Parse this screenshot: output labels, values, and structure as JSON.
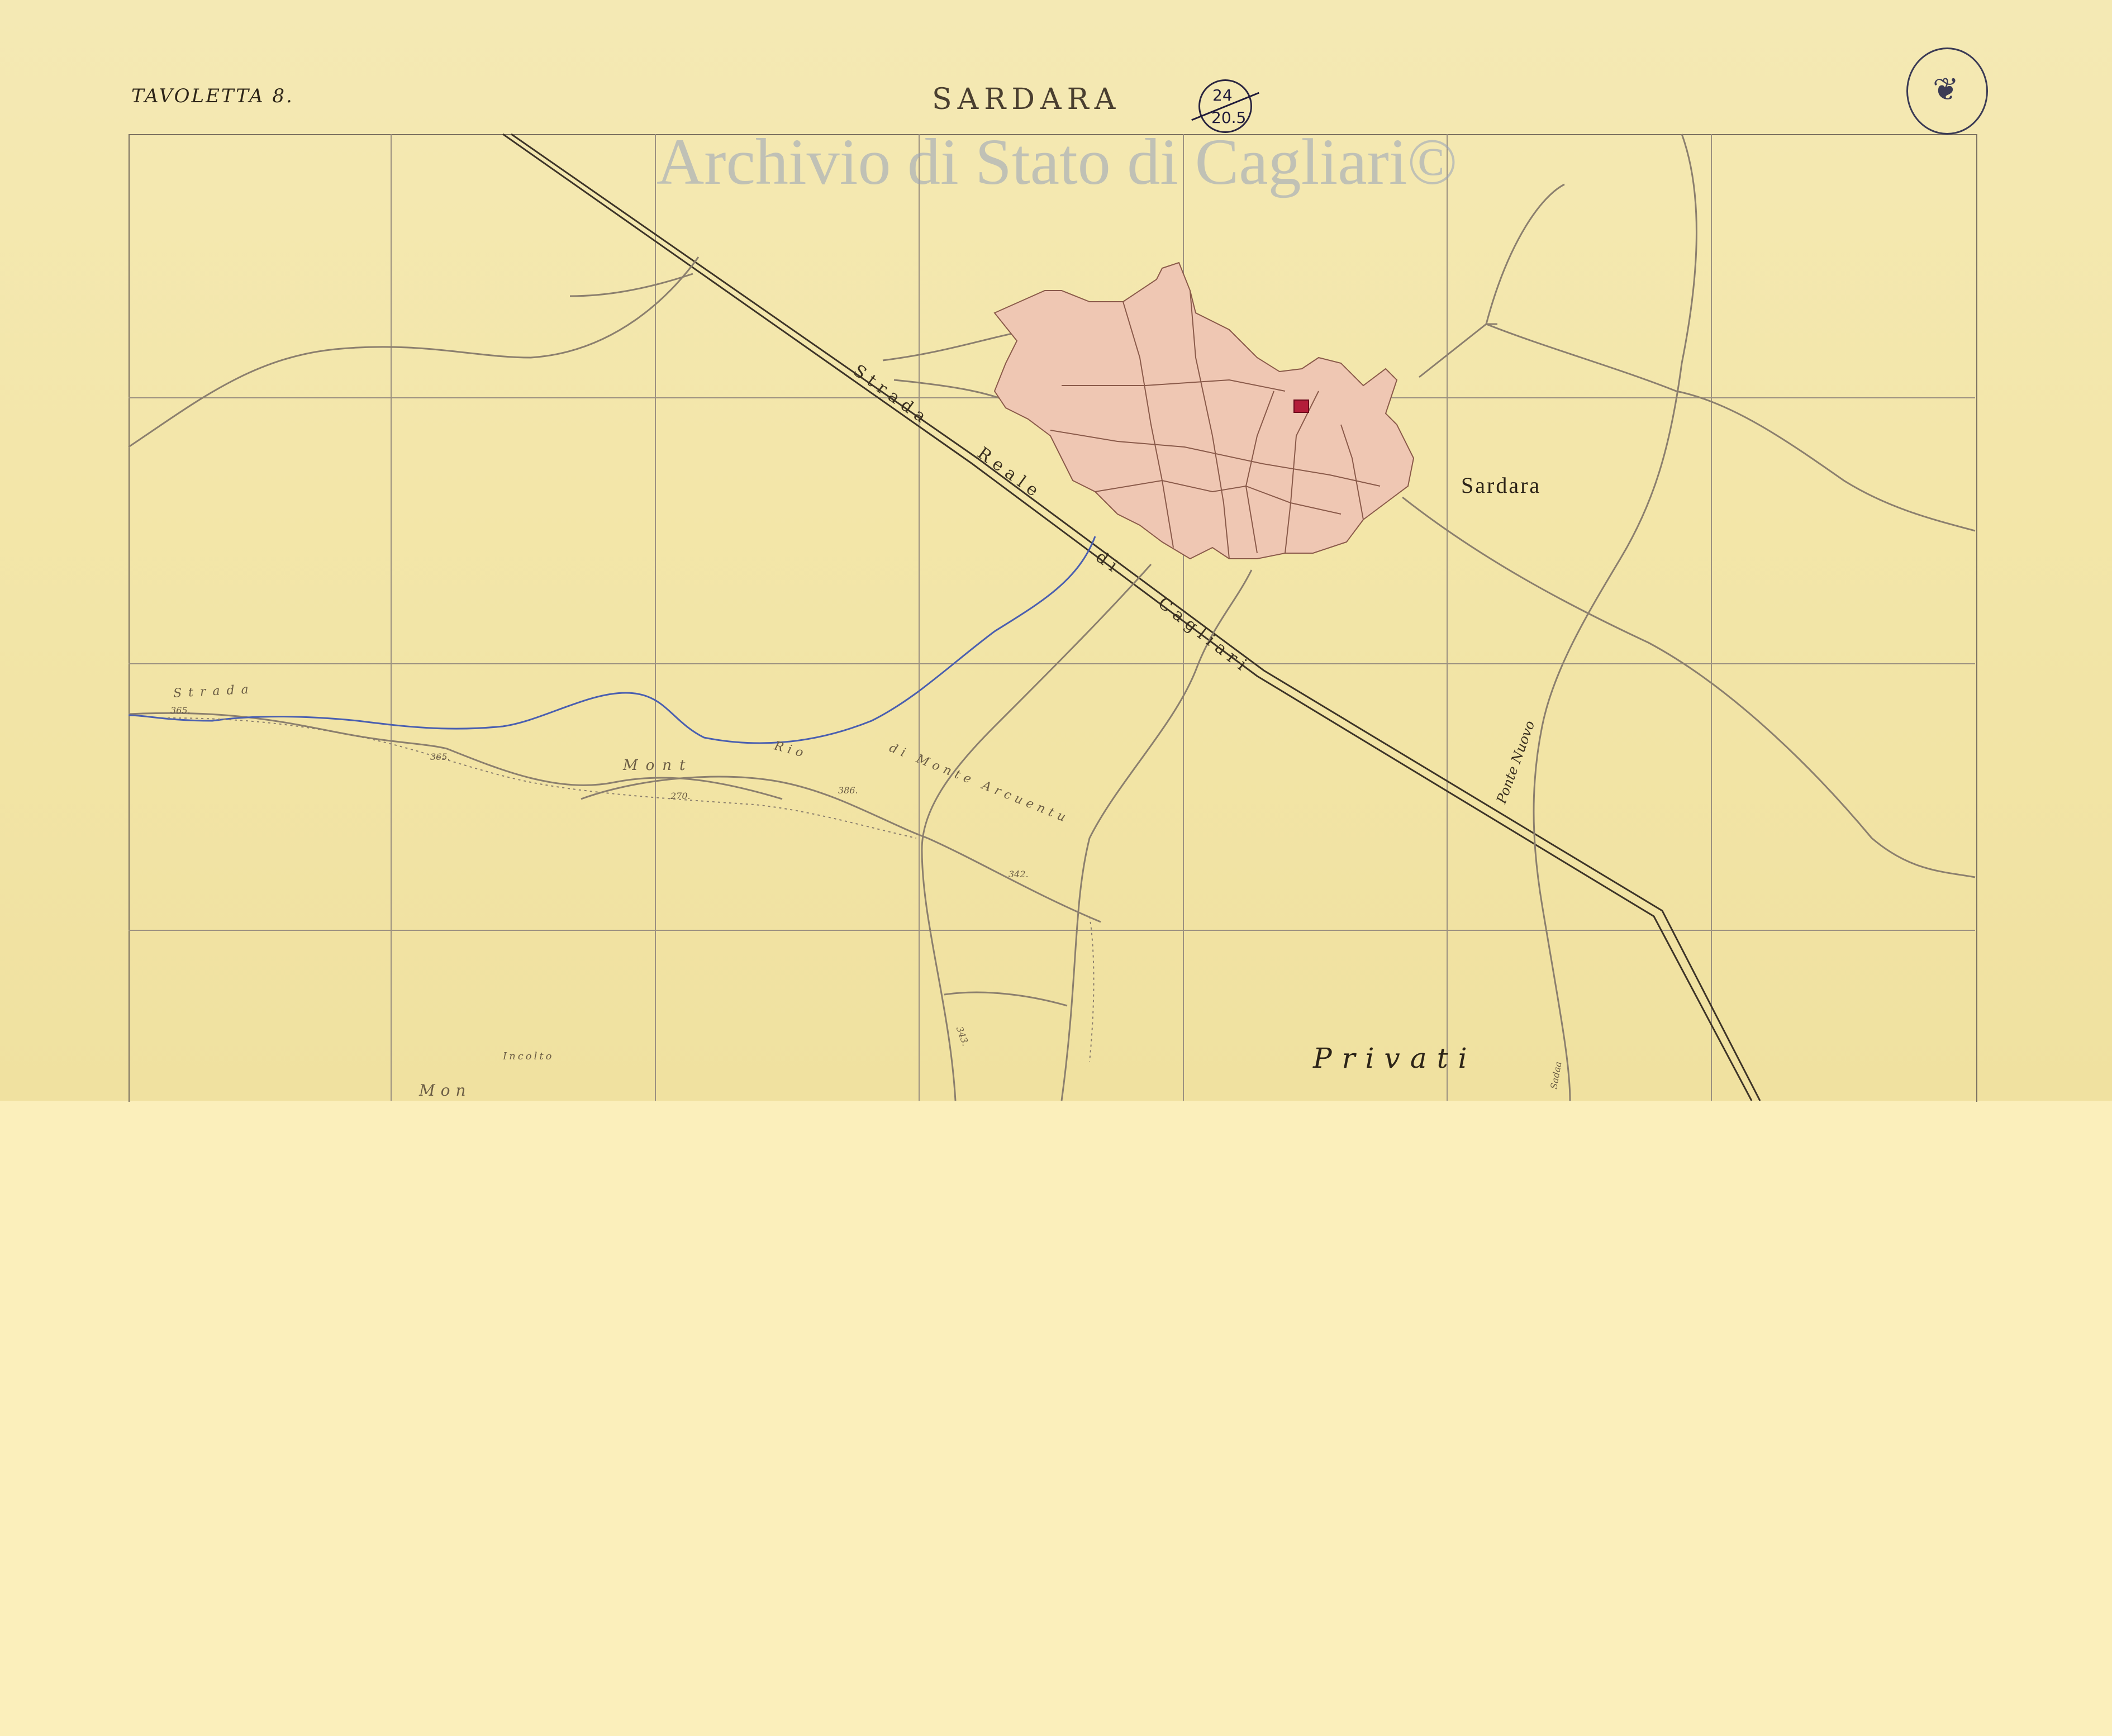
{
  "header": {
    "tavoletta": "TAVOLETTA 8.",
    "title": "SARDARA",
    "sheet_number_top": "24",
    "sheet_number_bottom": "20.5"
  },
  "watermark": "Archivio di Stato di Cagliari©",
  "stamp": {
    "icon": "eagle-seal-icon"
  },
  "map_labels": {
    "town": "Sardara",
    "road_1": "Strada",
    "road_2": "Reale",
    "road_3": "di",
    "road_4": "Cagliari",
    "strada_left": "Strada",
    "privati": "Privati",
    "mont": "Mont",
    "rio": "Rio",
    "monte_arcuentu": "di Monte Arcuentu",
    "elev_1": "365.",
    "elev_2": "365.",
    "elev_3": "270.",
    "elev_4": "386.",
    "elev_5": "342.",
    "elev_6": "343.",
    "incolto": "Incolto",
    "ponte": "Ponte Nuovo",
    "lower_text": "Mon",
    "vertical_text": "Sadaa"
  },
  "colors": {
    "paper": "#f3e6a9",
    "lower_area": "#fbefbb",
    "settlement": "#efc7b3",
    "church": "#b31e3a",
    "watermark": "#96a0b9",
    "river": "#4a5fb0"
  }
}
